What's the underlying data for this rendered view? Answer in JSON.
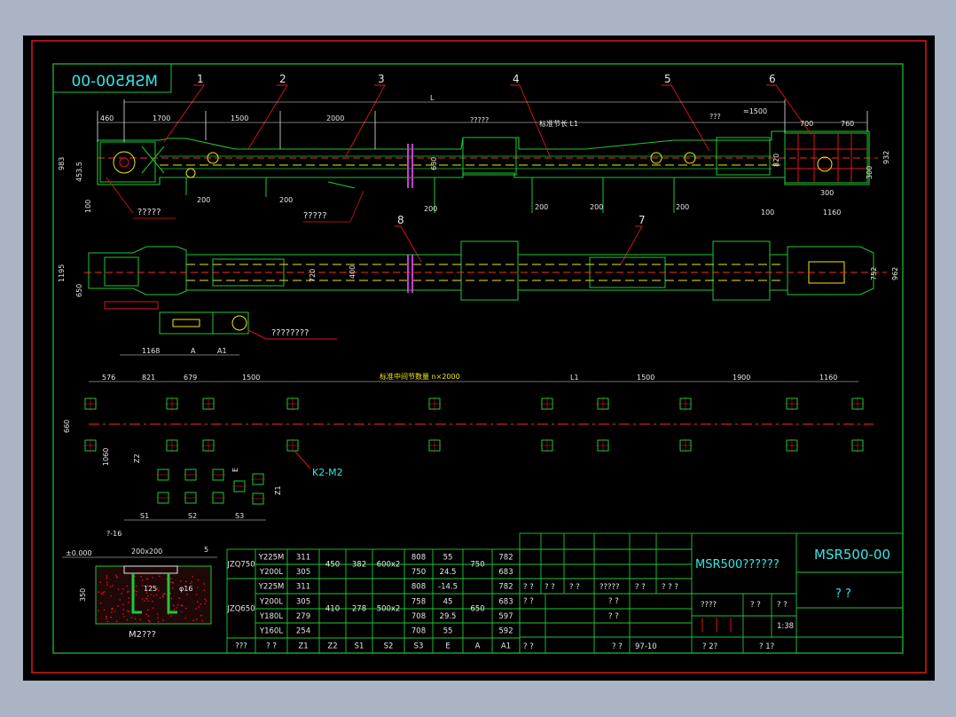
{
  "drawing_title": "MSR500-00",
  "title_mirrored": "MSR500-00",
  "title_block": {
    "name_cn": "MSR500??????",
    "drawing_no": "MSR500-00",
    "unit": "? ?",
    "cells": [
      "????",
      "? ?",
      "? ?"
    ],
    "scale": "1:38",
    "bottom_left": "? 2?",
    "bottom_right": "? 1?",
    "rev_cells": [
      "? ?",
      "? ?",
      "? ?",
      "?????",
      "? ?",
      "? ? ?"
    ],
    "row2_cells": [
      "? ?",
      "? ?"
    ],
    "row3_cells": [
      "? ?"
    ],
    "row4_cells": [
      "? ?",
      "? ?",
      "97-10"
    ]
  },
  "part_numbers": [
    "1",
    "2",
    "3",
    "4",
    "5",
    "6",
    "7",
    "8"
  ],
  "elevation_dims": {
    "total_length": "L",
    "top_dims": [
      "460",
      "1700",
      "1500",
      "2000",
      "700",
      "760"
    ],
    "approx": "≈1500",
    "section_label": "?????",
    "section_label_2": "???",
    "middle_label": "标准节长 L1",
    "height_left": "983",
    "height_left_2": "453.5",
    "height_right": "932",
    "height_mid": "820",
    "height_630": "630",
    "bottom_dims": [
      "200",
      "200",
      "200",
      "200",
      "200",
      "200",
      "100",
      "300",
      "1160",
      "300"
    ],
    "note_left": "?????",
    "note_mid": "?????",
    "left_100": "100"
  },
  "plan_dims": {
    "width_left": "1195",
    "width_650": "650",
    "width_720": "720",
    "width_400": "400",
    "width_752": "752",
    "width_962": "962",
    "drive_dims": [
      "1168",
      "A",
      "A1"
    ],
    "drive_label": "????????"
  },
  "foundation": {
    "dims": [
      "576",
      "821",
      "679",
      "1500",
      "L1",
      "1500",
      "1900",
      "1160"
    ],
    "middle_note": "标准中间节数量 n×2000",
    "height": "660",
    "height_2": "1060",
    "z1": "Z1",
    "z2": "Z2",
    "e": "E",
    "s_labels": [
      "S1",
      "S2",
      "S3"
    ],
    "bolt_label": "K2-M2"
  },
  "bolt_detail": {
    "level": "±0.000",
    "size": "200x200",
    "top_note": "?-16",
    "d1": "125",
    "d2": "φ16",
    "depth": "350",
    "caption": "M2???",
    "right_note": "5"
  },
  "spec_table": {
    "headers": [
      "???",
      "? ?",
      "Z1",
      "Z2",
      "S1",
      "S2",
      "S3",
      "E",
      "A",
      "A1"
    ],
    "groups": [
      {
        "reducer": "JZQ750",
        "z2": "450",
        "s1": "382",
        "s2": "600x2",
        "a": "750",
        "rows": [
          {
            "motor": "Y225M",
            "z1": "311",
            "s3": "808",
            "e": "55",
            "a1": "782"
          },
          {
            "motor": "Y200L",
            "z1": "305",
            "s3": "750",
            "e": "24.5",
            "a1": "683"
          }
        ]
      },
      {
        "reducer": "JZQ650",
        "z2": "410",
        "s1": "278",
        "s2": "500x2",
        "a": "650",
        "rows": [
          {
            "motor": "Y225M",
            "z1": "311",
            "s3": "808",
            "e": "-14.5",
            "a1": "782"
          },
          {
            "motor": "Y200L",
            "z1": "305",
            "s3": "758",
            "e": "45",
            "a1": "683"
          },
          {
            "motor": "Y180L",
            "z1": "279",
            "s3": "708",
            "e": "29.5",
            "a1": "597"
          },
          {
            "motor": "Y160L",
            "z1": "254",
            "s3": "708",
            "e": "55",
            "a1": "592"
          }
        ]
      }
    ]
  },
  "colors": {
    "background": "#000000",
    "outer_bg": "#aab4c4",
    "frame_red": "#e0141e",
    "border_green": "#1ec832",
    "cyan": "#37e6e6",
    "yellow": "#f0e614",
    "magenta": "#c83cd2",
    "white": "#e6e6e6",
    "red_line": "#ff2828"
  }
}
